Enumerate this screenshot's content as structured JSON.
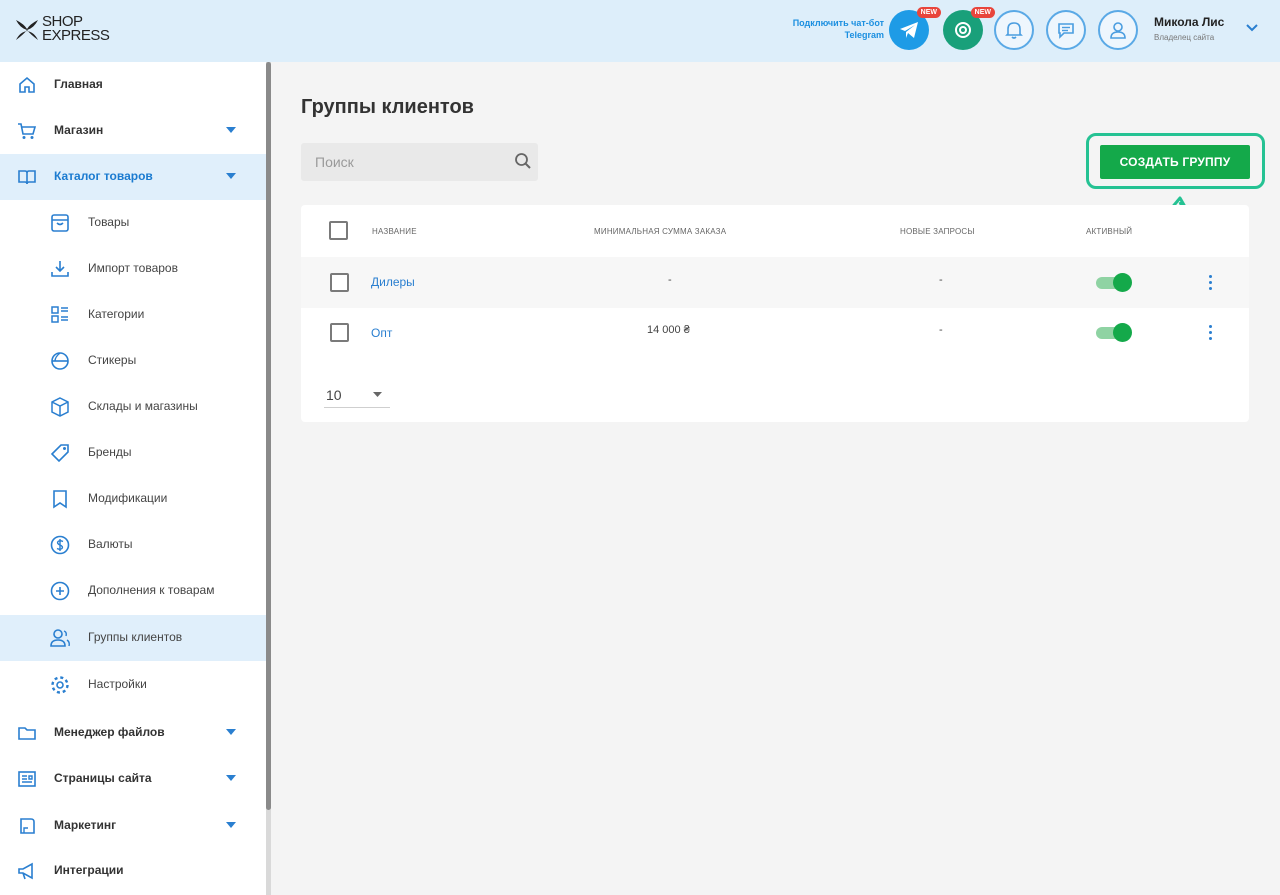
{
  "header": {
    "logo_line1": "SHOP",
    "logo_line2": "EXPRESS",
    "telegram_promo_line1": "Подключить чат-бот",
    "telegram_promo_line2": "Telegram",
    "badge_new": "NEW",
    "user_name": "Микола Лис",
    "user_role": "Владелец сайта"
  },
  "sidebar": {
    "items": [
      {
        "label": "Главная",
        "icon": "home-icon"
      },
      {
        "label": "Магазин",
        "icon": "cart-icon"
      },
      {
        "label": "Каталог товаров",
        "icon": "book-icon"
      }
    ],
    "sub_items": [
      {
        "label": "Товары",
        "icon": "box-icon"
      },
      {
        "label": "Импорт товаров",
        "icon": "download-icon"
      },
      {
        "label": "Категории",
        "icon": "categories-icon"
      },
      {
        "label": "Стикеры",
        "icon": "sticker-icon"
      },
      {
        "label": "Склады и магазины",
        "icon": "warehouse-icon"
      },
      {
        "label": "Бренды",
        "icon": "tag-icon"
      },
      {
        "label": "Модификации",
        "icon": "bookmark-icon"
      },
      {
        "label": "Валюты",
        "icon": "dollar-icon"
      },
      {
        "label": "Дополнения к товарам",
        "icon": "plus-circle-icon"
      },
      {
        "label": "Группы клиентов",
        "icon": "users-icon"
      },
      {
        "label": "Настройки",
        "icon": "gear-icon"
      }
    ],
    "bottom_items": [
      {
        "label": "Менеджер файлов",
        "icon": "folder-icon"
      },
      {
        "label": "Страницы сайта",
        "icon": "pages-icon"
      },
      {
        "label": "Маркетинг",
        "icon": "marketing-icon"
      },
      {
        "label": "Интеграции",
        "icon": "megaphone-icon"
      }
    ]
  },
  "main": {
    "title": "Группы клиентов",
    "search_placeholder": "Поиск",
    "create_button": "СОЗДАТЬ ГРУППУ",
    "columns": [
      "НАЗВАНИЕ",
      "МИНИМАЛЬНАЯ СУММА ЗАКАЗА",
      "НОВЫЕ ЗАПРОСЫ",
      "АКТИВНЫЙ"
    ],
    "rows": [
      {
        "name": "Дилеры",
        "min_sum": "-",
        "new_requests": "-",
        "active": true
      },
      {
        "name": "Опт",
        "min_sum": "14 000 ₴",
        "new_requests": "-",
        "active": true
      }
    ],
    "page_size": "10"
  },
  "colors": {
    "accent_blue": "#1b7bd0",
    "primary_green": "#14a94a",
    "highlight_teal": "#25c293",
    "header_bg": "#ddeefa"
  }
}
